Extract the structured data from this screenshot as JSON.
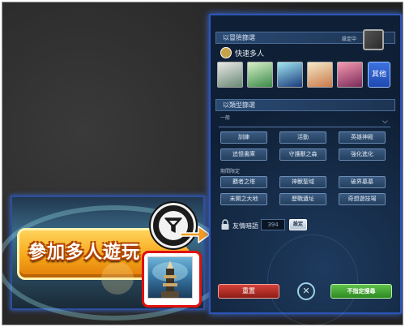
{
  "banner": {
    "title": "參加多人遊玩"
  },
  "panel": {
    "section_adventure": "以冒險篩選",
    "section_adventure_tag": "設定中",
    "fast_multi": "快速多人",
    "other_button": "其他",
    "section_type": "以類型篩選",
    "general_label": "一般",
    "general_buttons": [
      "訓練",
      "活動",
      "英雄神殿",
      "追憶書庫",
      "守護獸之森",
      "強化進化"
    ],
    "limited_label": "期間限定",
    "limited_buttons": [
      "覇者之塔",
      "神獸聖域",
      "破界墓墓",
      "未開之大地",
      "歷戰遺址",
      "奇想遊技場"
    ],
    "friend_label": "友情暗語",
    "friend_placeholder": "394",
    "set_button": "設定",
    "reset_button": "重置",
    "search_button": "不指定搜尋"
  },
  "colors": {
    "panel_border": "#2d55b8",
    "highlight": "#e01010",
    "arrow": "#f39a1e",
    "search": "#3da52e",
    "reset": "#b02c25"
  }
}
